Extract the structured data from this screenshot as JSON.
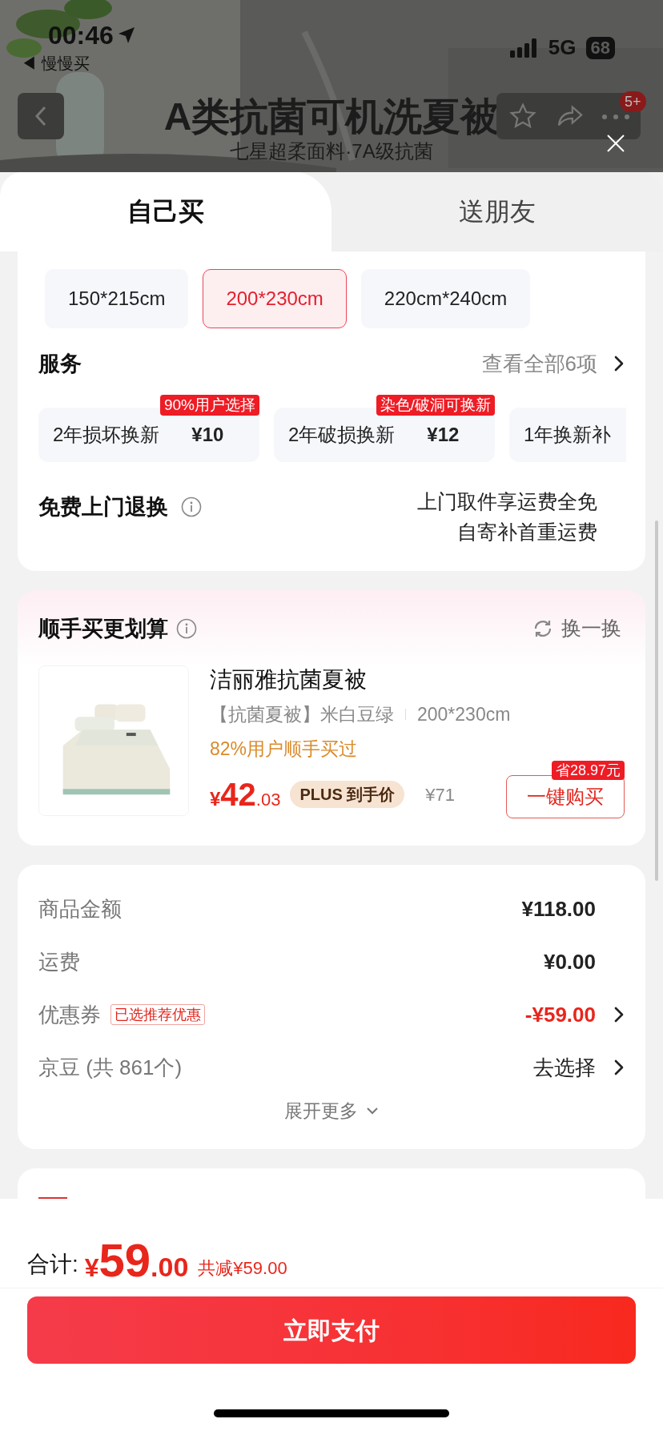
{
  "status_bar": {
    "time": "00:46",
    "back_app": "◀ 慢慢买",
    "network": "5G",
    "battery": "68"
  },
  "header": {
    "title": "A类抗菌可机洗夏被",
    "subtitle": "七星超柔面料·7A级抗菌",
    "badge": "5+"
  },
  "tabs": [
    {
      "label": "自己买",
      "selected": true
    },
    {
      "label": "送朋友",
      "selected": false
    }
  ],
  "sizes": [
    {
      "label": "150*215cm",
      "selected": false
    },
    {
      "label": "200*230cm",
      "selected": true
    },
    {
      "label": "220cm*240cm",
      "selected": false
    }
  ],
  "services": {
    "title": "服务",
    "view_all": "查看全部6项",
    "items": [
      {
        "name": "2年损坏换新",
        "price": "¥10",
        "badge": "90%用户选择"
      },
      {
        "name": "2年破损换新",
        "price": "¥12",
        "badge": "染色/破洞可换新"
      },
      {
        "name": "1年换新补"
      }
    ]
  },
  "free_return": {
    "title": "免费上门退换",
    "lines": [
      "上门取件享运费全免",
      "自寄补首重运费"
    ]
  },
  "addon": {
    "title": "顺手买更划算",
    "refresh": "换一换",
    "product": {
      "name": "洁丽雅抗菌夏被",
      "spec": "【抗菌夏被】米白豆绿",
      "size": "200*230cm",
      "hint": "82%用户顺手买过",
      "price_symbol": "¥",
      "price_int": "42",
      "price_dec": ".03",
      "plus": "PLUS 到手价",
      "orig": "¥71",
      "save": "省28.97元",
      "buy": "一键购买"
    }
  },
  "costs": [
    {
      "label": "商品金额",
      "value": "¥118.00",
      "kind": "plain"
    },
    {
      "label": "运费",
      "value": "¥0.00",
      "kind": "plain"
    },
    {
      "label": "优惠券",
      "tag": "已选推荐优惠",
      "value": "-¥59.00",
      "kind": "discount"
    },
    {
      "label": "京豆 (共 861个)",
      "value": "去选择",
      "kind": "link"
    }
  ],
  "expand": "展开更多",
  "footer": {
    "total_label": "合计:",
    "symbol": "¥",
    "int": "59",
    "dec": ".00",
    "saved": "共减¥59.00",
    "pay": "立即支付"
  }
}
